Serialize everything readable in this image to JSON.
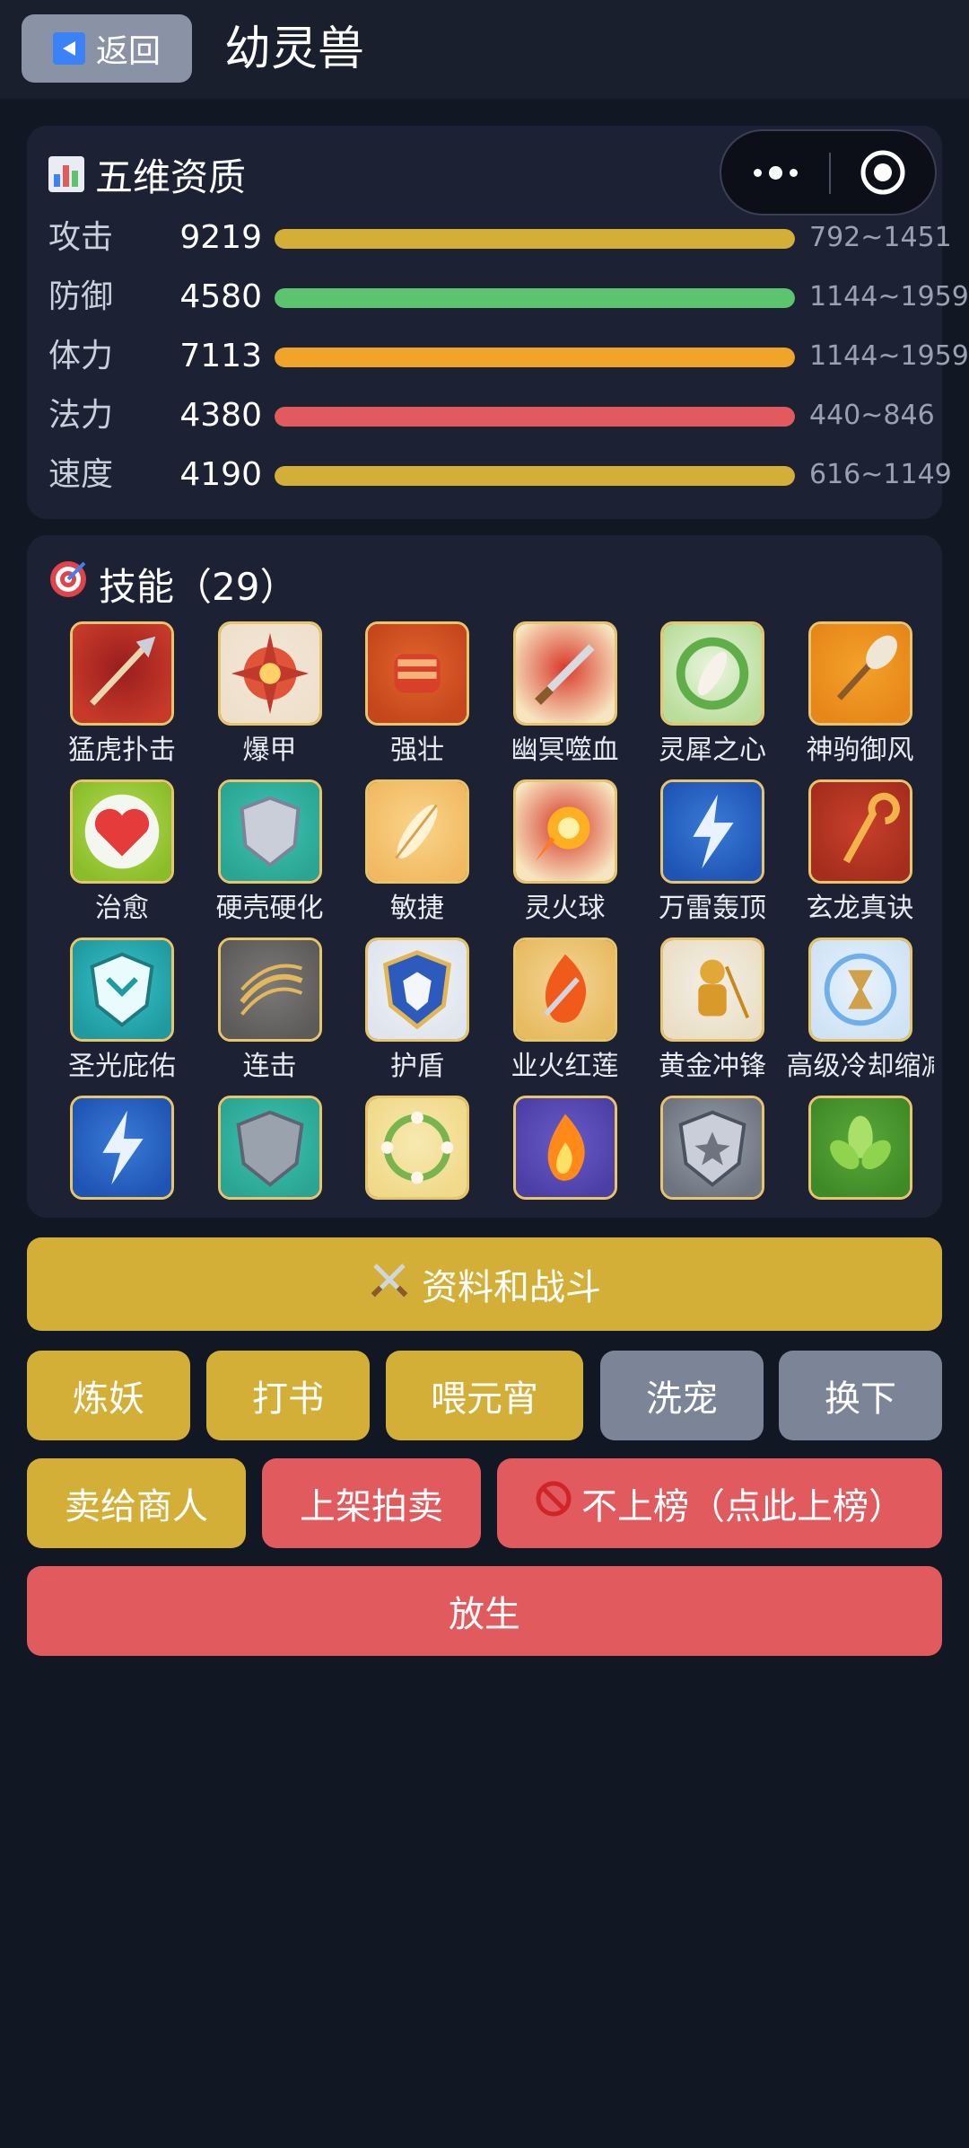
{
  "header": {
    "back_label": "返回",
    "title": "幼灵兽"
  },
  "stats": {
    "title": "五维资质",
    "rows": [
      {
        "label": "攻击",
        "value": "9219",
        "range": "792~1451",
        "color": "#d4af37",
        "fill": 1.0
      },
      {
        "label": "防御",
        "value": "4580",
        "range": "1144~1959",
        "color": "#5cc46e",
        "fill": 1.0
      },
      {
        "label": "体力",
        "value": "7113",
        "range": "1144~1959",
        "color": "#f0a42a",
        "fill": 1.0
      },
      {
        "label": "法力",
        "value": "4380",
        "range": "440~846",
        "color": "#e05a5e",
        "fill": 1.0
      },
      {
        "label": "速度",
        "value": "4190",
        "range": "616~1149",
        "color": "#d4af37",
        "fill": 1.0
      }
    ]
  },
  "skills": {
    "title": "技能（29）",
    "items": [
      {
        "name": "猛虎扑击",
        "icon": "spear-icon"
      },
      {
        "name": "爆甲",
        "icon": "burst-armor-icon"
      },
      {
        "name": "强壮",
        "icon": "fist-icon"
      },
      {
        "name": "幽冥噬血",
        "icon": "dagger-icon"
      },
      {
        "name": "灵犀之心",
        "icon": "feather-wreath-icon"
      },
      {
        "name": "神驹御风",
        "icon": "horse-tail-icon"
      },
      {
        "name": "治愈",
        "icon": "heart-icon"
      },
      {
        "name": "硬壳硬化",
        "icon": "shield-icon"
      },
      {
        "name": "敏捷",
        "icon": "feather-icon"
      },
      {
        "name": "灵火球",
        "icon": "fireball-icon"
      },
      {
        "name": "万雷轰顶",
        "icon": "lightning-icon"
      },
      {
        "name": "玄龙真诀",
        "icon": "staff-icon"
      },
      {
        "name": "圣光庇佑",
        "icon": "holy-shield-icon"
      },
      {
        "name": "连击",
        "icon": "combo-icon"
      },
      {
        "name": "护盾",
        "icon": "blue-shield-icon"
      },
      {
        "name": "业火红莲",
        "icon": "flame-blade-icon"
      },
      {
        "name": "黄金冲锋",
        "icon": "golden-warrior-icon"
      },
      {
        "name": "高级冷却缩减",
        "icon": "hourglass-icon"
      },
      {
        "name": "",
        "icon": "lightning-icon"
      },
      {
        "name": "",
        "icon": "silver-shield-icon"
      },
      {
        "name": "",
        "icon": "flower-wreath-icon"
      },
      {
        "name": "",
        "icon": "flame-icon"
      },
      {
        "name": "",
        "icon": "emblem-icon"
      },
      {
        "name": "",
        "icon": "leaf-icon"
      }
    ]
  },
  "buttons": {
    "info_battle": "资料和战斗",
    "refine": "炼妖",
    "book": "打书",
    "feed": "喂元宵",
    "wash": "洗宠",
    "swap": "换下",
    "sell": "卖给商人",
    "auction": "上架拍卖",
    "rank": "不上榜（点此上榜）",
    "release": "放生"
  }
}
